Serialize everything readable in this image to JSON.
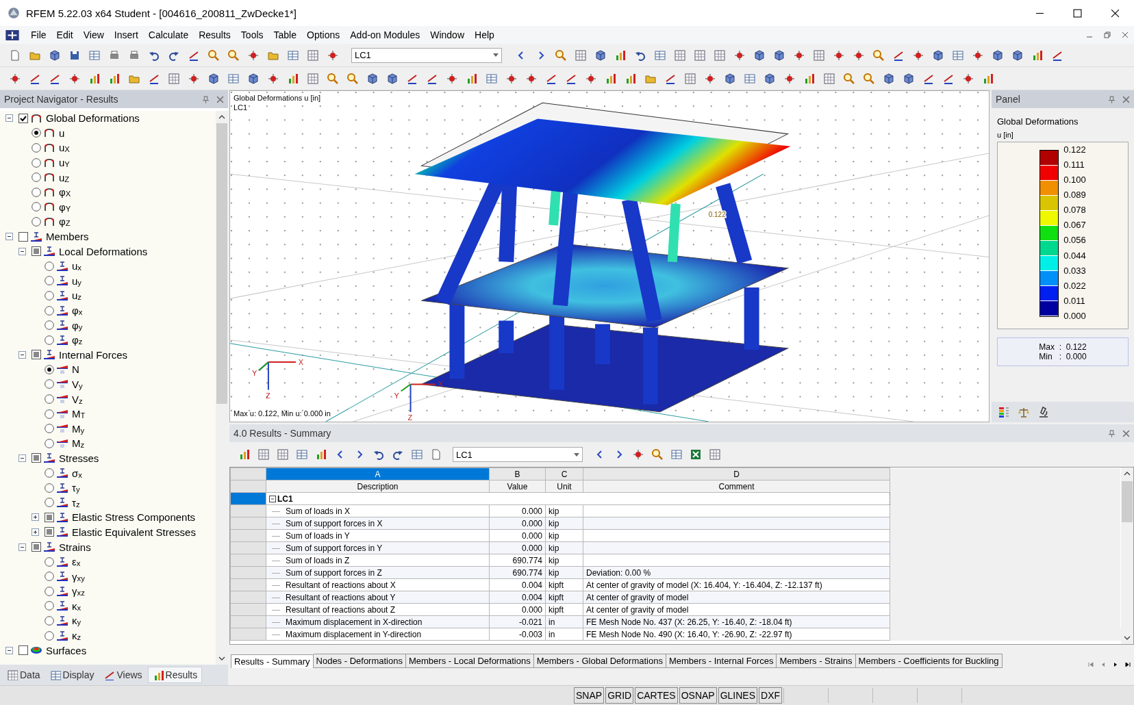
{
  "window": {
    "title": "RFEM 5.22.03 x64 Student - [004616_200811_ZwDecke1*]"
  },
  "menu": [
    "File",
    "Edit",
    "View",
    "Insert",
    "Calculate",
    "Results",
    "Tools",
    "Table",
    "Options",
    "Add-on Modules",
    "Window",
    "Help"
  ],
  "toolbar": {
    "load_case": "LC1"
  },
  "navigator": {
    "title": "Project Navigator - Results",
    "tree": [
      {
        "label": "Global Deformations",
        "checked": true,
        "expanded": true,
        "kind": "deformation",
        "children": [
          {
            "label": "u",
            "selected": true,
            "kind": "deformation"
          },
          {
            "label": "u$_{X}$",
            "selected": false,
            "kind": "deformation"
          },
          {
            "label": "u$_{Y}$",
            "selected": false,
            "kind": "deformation"
          },
          {
            "label": "u$_{Z}$",
            "selected": false,
            "kind": "deformation"
          },
          {
            "label": "φ$_{X}$",
            "selected": false,
            "kind": "deformation"
          },
          {
            "label": "φ$_{Y}$",
            "selected": false,
            "kind": "deformation"
          },
          {
            "label": "φ$_{Z}$",
            "selected": false,
            "kind": "deformation"
          }
        ]
      },
      {
        "label": "Members",
        "checked": false,
        "partial": false,
        "expanded": true,
        "kind": "member",
        "children": [
          {
            "label": "Local Deformations",
            "checked": false,
            "partial": true,
            "expanded": true,
            "kind": "member",
            "children": [
              {
                "label": "u$_{x}$",
                "selected": false,
                "kind": "member"
              },
              {
                "label": "u$_{y}$",
                "selected": false,
                "kind": "member"
              },
              {
                "label": "u$_{z}$",
                "selected": false,
                "kind": "member"
              },
              {
                "label": "φ$_{x}$",
                "selected": false,
                "kind": "member"
              },
              {
                "label": "φ$_{y}$",
                "selected": false,
                "kind": "member"
              },
              {
                "label": "φ$_{z}$",
                "selected": false,
                "kind": "member"
              }
            ]
          },
          {
            "label": "Internal Forces",
            "checked": false,
            "partial": true,
            "expanded": true,
            "kind": "member",
            "children": [
              {
                "label": "N",
                "selected": true,
                "kind": "force"
              },
              {
                "label": "V$_{y}$",
                "selected": false,
                "kind": "force"
              },
              {
                "label": "V$_{z}$",
                "selected": false,
                "kind": "force"
              },
              {
                "label": "M$_{T}$",
                "selected": false,
                "kind": "force"
              },
              {
                "label": "M$_{y}$",
                "selected": false,
                "kind": "force"
              },
              {
                "label": "M$_{z}$",
                "selected": false,
                "kind": "force"
              }
            ]
          },
          {
            "label": "Stresses",
            "checked": false,
            "partial": true,
            "expanded": true,
            "kind": "member",
            "children": [
              {
                "label": "σ$_{x}$",
                "selected": false,
                "kind": "member"
              },
              {
                "label": "τ$_{y}$",
                "selected": false,
                "kind": "member"
              },
              {
                "label": "τ$_{z}$",
                "selected": false,
                "kind": "member"
              },
              {
                "label": "Elastic Stress Components",
                "checked": false,
                "partial": true,
                "expanded": false,
                "kind": "member"
              },
              {
                "label": "Elastic Equivalent Stresses",
                "checked": false,
                "partial": true,
                "expanded": false,
                "kind": "member"
              }
            ]
          },
          {
            "label": "Strains",
            "checked": false,
            "partial": true,
            "expanded": true,
            "kind": "member",
            "children": [
              {
                "label": "ε$_{x}$",
                "selected": false,
                "kind": "member"
              },
              {
                "label": "γ$_{xy}$",
                "selected": false,
                "kind": "member"
              },
              {
                "label": "γ$_{xz}$",
                "selected": false,
                "kind": "member"
              },
              {
                "label": "κ$_{x}$",
                "selected": false,
                "kind": "member"
              },
              {
                "label": "κ$_{y}$",
                "selected": false,
                "kind": "member"
              },
              {
                "label": "κ$_{z}$",
                "selected": false,
                "kind": "member"
              }
            ]
          }
        ]
      },
      {
        "label": "Surfaces",
        "checked": false,
        "partial": false,
        "expanded": true,
        "kind": "surface"
      }
    ],
    "tabs": [
      {
        "label": "Data",
        "selected": false
      },
      {
        "label": "Display",
        "selected": false
      },
      {
        "label": "Views",
        "selected": false
      },
      {
        "label": "Results",
        "selected": true
      }
    ]
  },
  "viewport": {
    "title": "Global Deformations u [in]",
    "load_case": "LC1",
    "max_marker": "0.122",
    "footer": "Max u: 0.122, Min u: 0.000 in",
    "axes": [
      {
        "x": "X",
        "y": "Y",
        "z": "Z"
      },
      {
        "x": "X",
        "y": "Y",
        "z": "Z"
      }
    ]
  },
  "panel": {
    "title": "Panel",
    "heading": "Global Deformations",
    "unit": "u [in]",
    "ticks": [
      "0.122",
      "0.111",
      "0.100",
      "0.089",
      "0.078",
      "0.067",
      "0.056",
      "0.044",
      "0.033",
      "0.022",
      "0.011",
      "0.000"
    ],
    "bands": [
      {
        "color": "#b00000"
      },
      {
        "color": "#f00000"
      },
      {
        "color": "#f09000"
      },
      {
        "color": "#d8c400"
      },
      {
        "color": "#f0f800"
      },
      {
        "color": "#10e010"
      },
      {
        "color": "#00d890"
      },
      {
        "color": "#00f0e8"
      },
      {
        "color": "#0090f8"
      },
      {
        "color": "#0020f0"
      },
      {
        "color": "#0000a0"
      }
    ],
    "max": "Max  :  0.122",
    "min": "Min   :  0.000"
  },
  "results": {
    "title": "4.0 Results - Summary",
    "load_case": "LC1",
    "columns": [
      {
        "letter": "A",
        "label": "Description",
        "selected": true
      },
      {
        "letter": "B",
        "label": "Value",
        "selected": false
      },
      {
        "letter": "C",
        "label": "Unit",
        "selected": false
      },
      {
        "letter": "D",
        "label": "Comment",
        "selected": false
      }
    ],
    "group": {
      "label": "LC1",
      "expanded": true,
      "selected": true
    },
    "rows": [
      {
        "description": "Sum of loads in X",
        "value": "0.000",
        "unit": "kip",
        "comment": ""
      },
      {
        "description": "Sum of support forces in X",
        "value": "0.000",
        "unit": "kip",
        "comment": ""
      },
      {
        "description": "Sum of loads in Y",
        "value": "0.000",
        "unit": "kip",
        "comment": ""
      },
      {
        "description": "Sum of support forces in Y",
        "value": "0.000",
        "unit": "kip",
        "comment": ""
      },
      {
        "description": "Sum of loads in Z",
        "value": "690.774",
        "unit": "kip",
        "comment": ""
      },
      {
        "description": "Sum of support forces in Z",
        "value": "690.774",
        "unit": "kip",
        "comment": "Deviation:  0.00 %"
      },
      {
        "description": "Resultant of reactions about X",
        "value": "0.004",
        "unit": "kipft",
        "comment": "At center of gravity of model (X: 16.404, Y: -16.404, Z: -12.137 ft)"
      },
      {
        "description": "Resultant of reactions about Y",
        "value": "0.004",
        "unit": "kipft",
        "comment": "At center of gravity of model"
      },
      {
        "description": "Resultant of reactions about Z",
        "value": "0.000",
        "unit": "kipft",
        "comment": "At center of gravity of model"
      },
      {
        "description": "Maximum displacement in X-direction",
        "value": "-0.021",
        "unit": "in",
        "comment": "FE Mesh Node No. 437  (X: 26.25,  Y: -16.40,  Z: -18.04 ft)"
      },
      {
        "description": "Maximum displacement in Y-direction",
        "value": "-0.003",
        "unit": "in",
        "comment": "FE Mesh Node No. 490  (X: 16.40,  Y: -26.90,  Z: -22.97 ft)"
      }
    ],
    "sheets": [
      {
        "label": "Results - Summary",
        "selected": true
      },
      {
        "label": "Nodes - Deformations",
        "selected": false
      },
      {
        "label": "Members - Local Deformations",
        "selected": false
      },
      {
        "label": "Members - Global Deformations",
        "selected": false
      },
      {
        "label": "Members - Internal Forces",
        "selected": false
      },
      {
        "label": "Members - Strains",
        "selected": false
      },
      {
        "label": "Members - Coefficients for Buckling",
        "selected": false
      }
    ]
  },
  "status_bar": [
    "SNAP",
    "GRID",
    "CARTES",
    "OSNAP",
    "GLINES",
    "DXF"
  ]
}
